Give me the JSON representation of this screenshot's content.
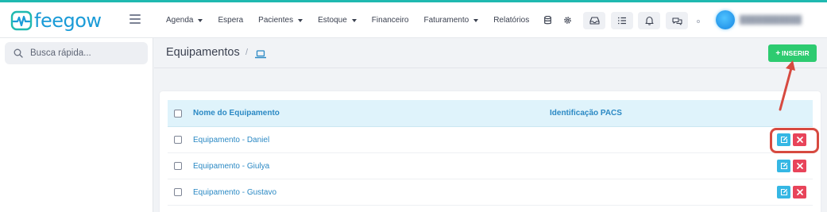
{
  "brand": {
    "name": "feegow",
    "color": "#1a9bd7",
    "accent": "#1fb9b0"
  },
  "nav": {
    "items": [
      {
        "label": "Agenda",
        "dropdown": true
      },
      {
        "label": "Espera",
        "dropdown": false
      },
      {
        "label": "Pacientes",
        "dropdown": true
      },
      {
        "label": "Estoque",
        "dropdown": true
      },
      {
        "label": "Financeiro",
        "dropdown": false
      },
      {
        "label": "Faturamento",
        "dropdown": true
      },
      {
        "label": "Relatórios",
        "dropdown": false
      }
    ],
    "icons": [
      "database-icon",
      "gear-icon"
    ],
    "toolbar_icons": [
      "inbox-icon",
      "checklist-icon",
      "bell-icon",
      "chat-icon"
    ]
  },
  "sidebar": {
    "search_placeholder": "Busca rápida..."
  },
  "page": {
    "title": "Equipamentos",
    "breadcrumb_separator": "/",
    "breadcrumb_icon": "laptop-icon"
  },
  "actions": {
    "insert_label": "INSERIR",
    "insert_icon": "plus-icon",
    "insert_color": "#2dcb70"
  },
  "table": {
    "columns": [
      "Nome do Equipamento",
      "Identificação PACS"
    ],
    "rows": [
      {
        "name": "Equipamento - Daniel",
        "pacs": ""
      },
      {
        "name": "Equipamento - Giulya",
        "pacs": ""
      },
      {
        "name": "Equipamento - Gustavo",
        "pacs": ""
      }
    ],
    "row_actions": [
      "edit-icon",
      "delete-icon"
    ],
    "edit_color": "#35b7e4",
    "delete_color": "#e8445a"
  },
  "annotation": {
    "color": "#d74a40"
  }
}
